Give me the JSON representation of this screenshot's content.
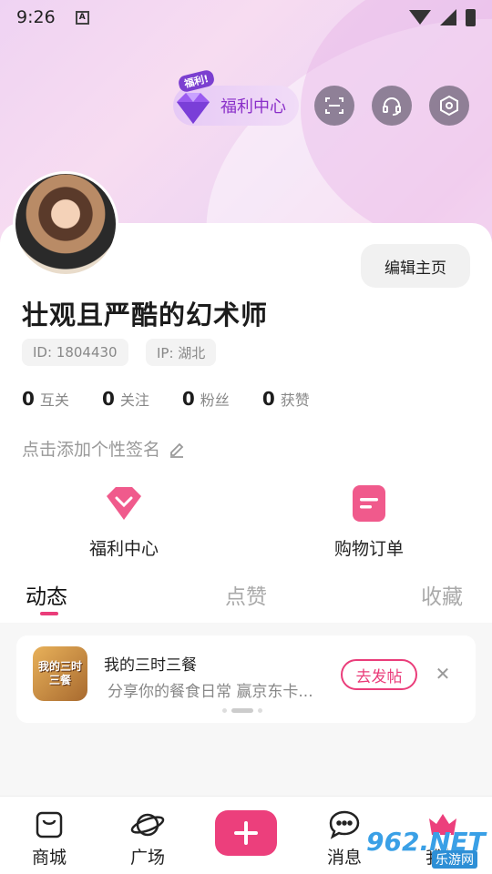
{
  "status_bar": {
    "time": "9:26",
    "notification_glyph": "A"
  },
  "header": {
    "welfare_tag": "福利!",
    "welfare_label": "福利中心",
    "icons": [
      "scan-icon",
      "headset-icon",
      "settings-icon"
    ]
  },
  "profile": {
    "edit_label": "编辑主页",
    "nickname": "壮观且严酷的幻术师",
    "id_chip": "ID: 1804430",
    "ip_chip": "IP: 湖北",
    "stats": [
      {
        "value": "0",
        "label": "互关"
      },
      {
        "value": "0",
        "label": "关注"
      },
      {
        "value": "0",
        "label": "粉丝"
      },
      {
        "value": "0",
        "label": "获赞"
      }
    ],
    "signature_placeholder": "点击添加个性签名"
  },
  "features": [
    {
      "label": "福利中心",
      "icon": "gift-heart-icon"
    },
    {
      "label": "购物订单",
      "icon": "order-list-icon"
    }
  ],
  "tabs": [
    {
      "label": "动态",
      "active": true
    },
    {
      "label": "点赞",
      "active": false
    },
    {
      "label": "收藏",
      "active": false
    }
  ],
  "promo": {
    "thumb_text": "我的三时三餐",
    "title": "我的三时三餐",
    "subtitle": "分享你的餐食日常 赢京东卡...",
    "button": "去发帖"
  },
  "bottom_nav": [
    {
      "label": "商城",
      "icon": "shopping-bag-icon"
    },
    {
      "label": "广场",
      "icon": "planet-icon"
    },
    {
      "label": "",
      "icon": "plus-icon"
    },
    {
      "label": "消息",
      "icon": "chat-bubble-icon"
    },
    {
      "label": "我的",
      "icon": "crown-icon"
    }
  ],
  "watermark": {
    "brand": "962.NET",
    "sub": "乐游网"
  },
  "colors": {
    "accent": "#ec3f7c",
    "welfare_text": "#8a2fc9",
    "hero_bg": "#efd3f3"
  }
}
